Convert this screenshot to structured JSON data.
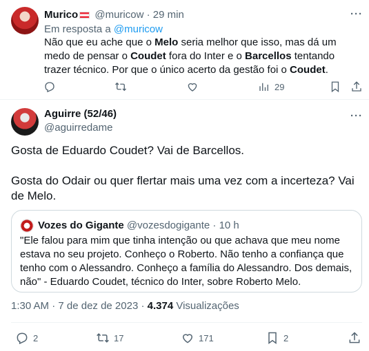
{
  "tweet1": {
    "name": "Murico",
    "handle": "@muricow",
    "time": "29 min",
    "reply_prefix": "Em resposta a",
    "reply_to": "@muricow",
    "text_parts": [
      {
        "t": "Não que eu ache que o ",
        "b": false
      },
      {
        "t": "Melo",
        "b": true
      },
      {
        "t": " seria melhor que isso, mas dá um medo de pensar o ",
        "b": false
      },
      {
        "t": "Coudet",
        "b": true
      },
      {
        "t": " fora do Inter e o ",
        "b": false
      },
      {
        "t": "Barcellos",
        "b": true
      },
      {
        "t": " tentando trazer técnico. Por que o único acerto da gestão foi o ",
        "b": false
      },
      {
        "t": "Coudet",
        "b": true
      },
      {
        "t": ".",
        "b": false
      }
    ],
    "views": "29"
  },
  "tweet2": {
    "name": "Aguirre (52/46)",
    "handle": "@aguirredame",
    "paragraphs": [
      "Gosta de Eduardo Coudet? Vai de Barcellos.",
      "Gosta do Odair ou quer flertar mais uma vez com a incerteza? Vai de Melo."
    ],
    "quote": {
      "name": "Vozes do Gigante",
      "handle": "@vozesdogigante",
      "time": "10 h",
      "text": "\"Ele falou para mim que tinha intenção ou que achava que meu nome estava no seu projeto. Conheço o Roberto. Não tenho a confiança que tenho com o Alessandro. Conheço a família do Alessandro. Dos demais, não\" - Eduardo Coudet, técnico do Inter, sobre Roberto Melo."
    },
    "timestamp": "1:30 AM · 7 de dez de 2023 ·",
    "views_count": "4.374",
    "views_label": "Visualizações",
    "replies": "2",
    "retweets": "17",
    "likes": "171",
    "bookmarks": "2"
  },
  "icons": [
    "reply-icon",
    "retweet-icon",
    "like-icon",
    "views-icon",
    "bookmark-icon",
    "share-icon",
    "more-icon"
  ]
}
